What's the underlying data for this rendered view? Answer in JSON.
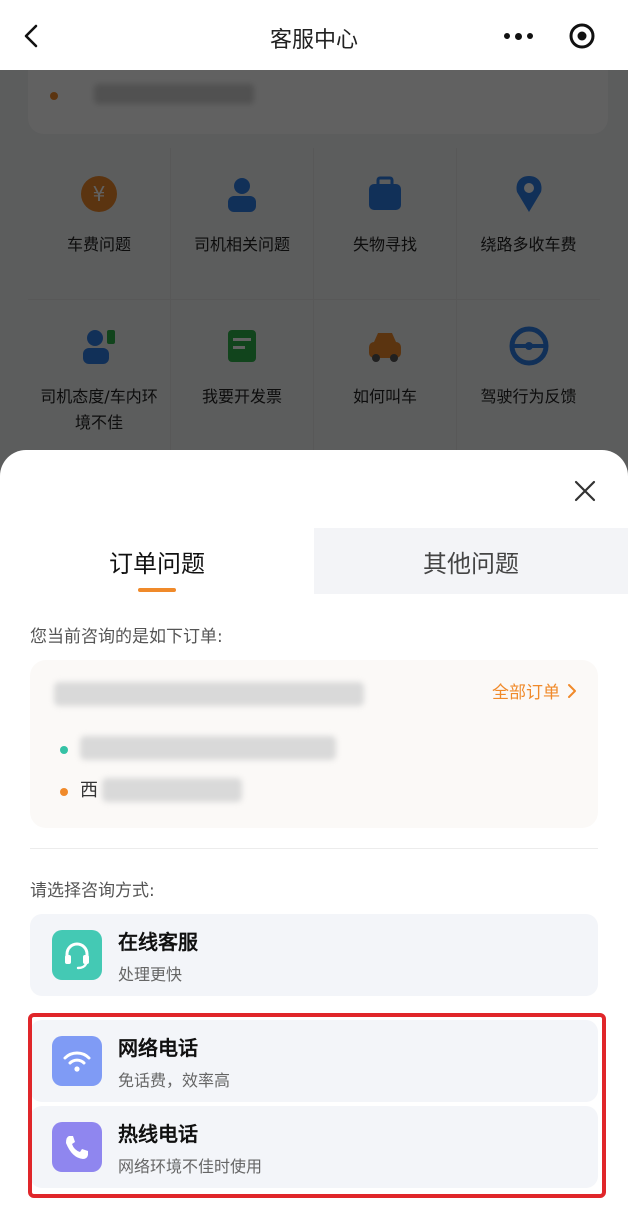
{
  "navbar": {
    "title": "客服中心"
  },
  "background": {
    "grid_items": [
      {
        "label": "车费问题",
        "icon": "fare-icon",
        "color": "#f08a2a"
      },
      {
        "label": "司机相关问题",
        "icon": "driver-icon",
        "color": "#2f7fe8"
      },
      {
        "label": "失物寻找",
        "icon": "lost-bag-icon",
        "color": "#2f7fe8"
      },
      {
        "label": "绕路多收车费",
        "icon": "route-pin-icon",
        "color": "#2f7fe8"
      },
      {
        "label": "司机态度/车内环境不佳",
        "icon": "driver-attitude-icon",
        "color": "#2f7fe8"
      },
      {
        "label": "我要开发票",
        "icon": "invoice-icon",
        "color": "#2fb24a"
      },
      {
        "label": "如何叫车",
        "icon": "car-icon",
        "color": "#f08a2a"
      },
      {
        "label": "驾驶行为反馈",
        "icon": "steering-wheel-icon",
        "color": "#2f7fe8"
      }
    ]
  },
  "sheet": {
    "tabs": [
      {
        "label": "订单问题",
        "active": true
      },
      {
        "label": "其他问题",
        "active": false
      }
    ],
    "current_order_label": "您当前咨询的是如下订单:",
    "order": {
      "all_orders_label": "全部订单",
      "origin_prefix": "西"
    },
    "method_label": "请选择咨询方式:",
    "options": [
      {
        "title": "在线客服",
        "subtitle": "处理更快",
        "icon": "headset-icon",
        "color": "#44c9b4"
      },
      {
        "title": "网络电话",
        "subtitle": "免话费，效率高",
        "icon": "wifi-icon",
        "color": "#7f9bf5"
      },
      {
        "title": "热线电话",
        "subtitle": "网络环境不佳时使用",
        "icon": "phone-icon",
        "color": "#8f86ef"
      }
    ]
  }
}
